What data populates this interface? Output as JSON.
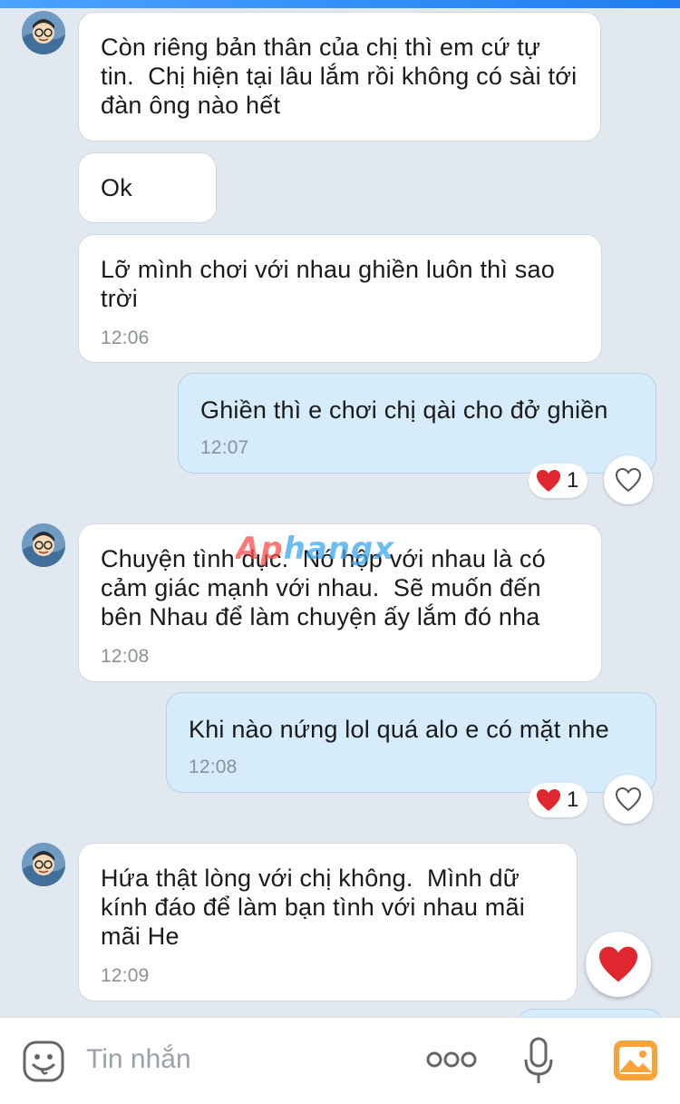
{
  "messages": [
    {
      "side": "in",
      "text": "Còn riêng bản thân của chị thì em cứ tự tin.  Chị hiện tại lâu lắm rồi không có sài tới đàn ông nào hết",
      "time": ""
    },
    {
      "side": "in",
      "text": "Ok",
      "time": ""
    },
    {
      "side": "in",
      "text": "Lỡ mình chơi với nhau ghiền luôn thì sao trời",
      "time": "12:06"
    },
    {
      "side": "out",
      "text": "Ghiền thì e chơi chị qài cho đở ghiền",
      "time": "12:07",
      "reaction_count": "1"
    },
    {
      "side": "in",
      "text": "Chuyện tình dục.  Nó hộp với nhau là có cảm giác mạnh với nhau.  Sẽ muốn đến bên Nhau để làm chuyện ấy lắm đó nha",
      "time": "12:08"
    },
    {
      "side": "out",
      "text": "Khi nào nứng lol quá alo e có mặt nhe",
      "time": "12:08",
      "reaction_count": "1"
    },
    {
      "side": "in",
      "text": "Hứa thật lòng với chị không.  Mình dữ kính đáo để làm bạn tình với nhau mãi mãi He",
      "time": "12:09"
    }
  ],
  "watermark": "Aphangx",
  "composer": {
    "placeholder": "Tin nhắn"
  },
  "icons": {
    "emoji": "emoji-icon",
    "more": "more-dots-icon",
    "mic": "microphone-icon",
    "photo": "photo-icon",
    "like": "heart-outline-icon",
    "reaction": "red-heart-icon"
  },
  "colors": {
    "incoming_bubble": "#ffffff",
    "outgoing_bubble": "#d6ecfb",
    "background": "#e2e8ef",
    "heart": "#e0262f",
    "photo_icon": "#f7a33a"
  }
}
